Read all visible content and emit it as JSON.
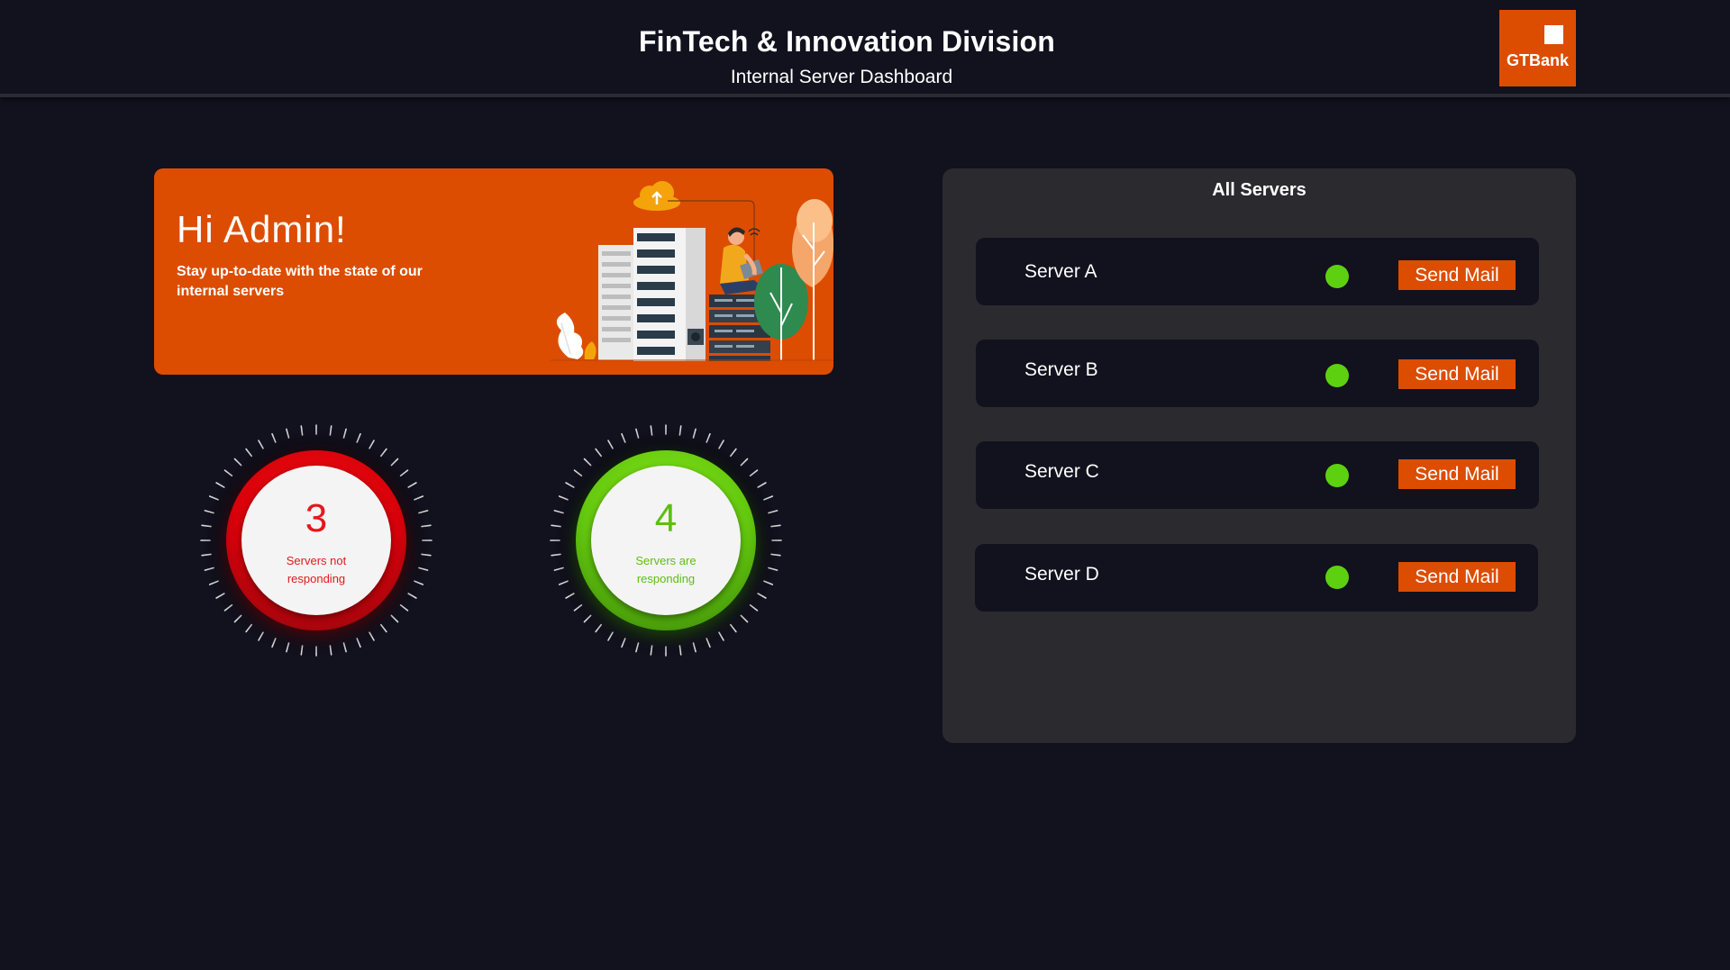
{
  "header": {
    "title": "FinTech & Innovation Division",
    "subtitle": "Internal Server Dashboard",
    "logo_text": "GTBank"
  },
  "banner": {
    "greeting": "Hi Admin!",
    "description": "Stay up-to-date with the state of our internal servers"
  },
  "gauges": {
    "not_responding": {
      "value": "3",
      "label": "Servers not responding",
      "color": "#e3181b"
    },
    "responding": {
      "value": "4",
      "label": "Servers are responding",
      "color": "#5dbf0f"
    }
  },
  "panel": {
    "title": "All Servers",
    "servers": [
      {
        "name": "Server A",
        "status_color": "#5dd10f",
        "button_label": "Send Mail"
      },
      {
        "name": "Server B",
        "status_color": "#5dd10f",
        "button_label": "Send Mail"
      },
      {
        "name": "Server C",
        "status_color": "#5dd10f",
        "button_label": "Send Mail"
      },
      {
        "name": "Server D",
        "status_color": "#5dd10f",
        "button_label": "Send Mail"
      }
    ]
  },
  "colors": {
    "background": "#12111e",
    "accent": "#dc4d01",
    "panel": "#2b2a2f",
    "success": "#5dd10f",
    "danger": "#e3181b"
  }
}
